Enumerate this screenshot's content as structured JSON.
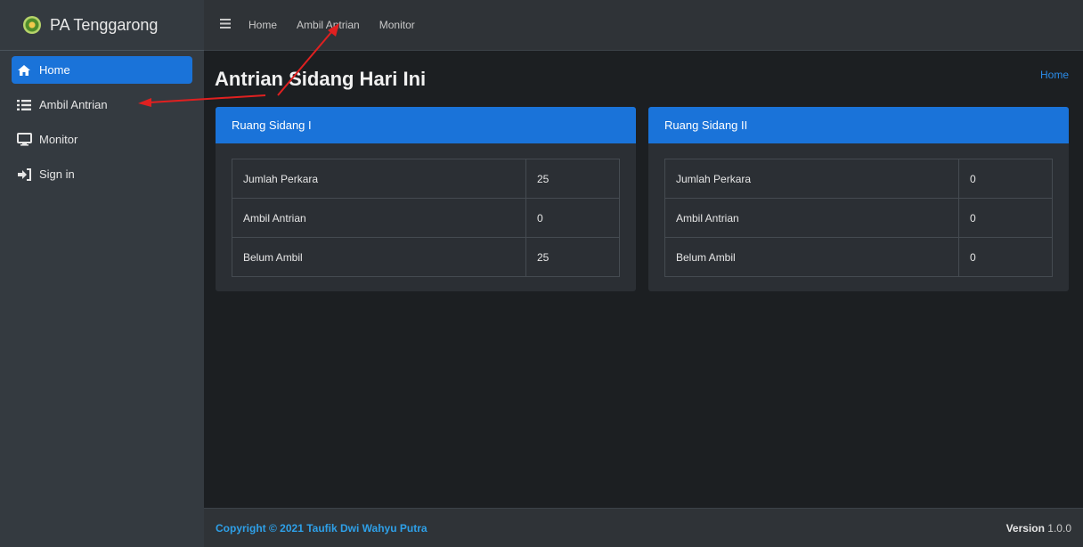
{
  "brand": {
    "name": "PA Tenggarong"
  },
  "sidebar": {
    "items": [
      {
        "label": "Home",
        "icon": "home-icon",
        "active": true
      },
      {
        "label": "Ambil Antrian",
        "icon": "list-icon",
        "active": false
      },
      {
        "label": "Monitor",
        "icon": "monitor-icon",
        "active": false
      },
      {
        "label": "Sign in",
        "icon": "sign-in-icon",
        "active": false
      }
    ]
  },
  "topbar": {
    "links": [
      "Home",
      "Ambil Antrian",
      "Monitor"
    ]
  },
  "page": {
    "title": "Antrian Sidang Hari Ini",
    "breadcrumb": "Home"
  },
  "cards": [
    {
      "title": "Ruang Sidang I",
      "rows": [
        {
          "label": "Jumlah Perkara",
          "value": "25"
        },
        {
          "label": "Ambil Antrian",
          "value": "0"
        },
        {
          "label": "Belum Ambil",
          "value": "25"
        }
      ]
    },
    {
      "title": "Ruang Sidang II",
      "rows": [
        {
          "label": "Jumlah Perkara",
          "value": "0"
        },
        {
          "label": "Ambil Antrian",
          "value": "0"
        },
        {
          "label": "Belum Ambil",
          "value": "0"
        }
      ]
    }
  ],
  "footer": {
    "copyright": "Copyright © 2021 Taufik Dwi Wahyu Putra",
    "version_label": "Version",
    "version_value": "1.0.0"
  },
  "colors": {
    "accent": "#1a73d9",
    "sidebar_bg": "#343a40",
    "content_bg": "#1c1f22",
    "link": "#2ea0e8",
    "annotation_arrow": "#e02020"
  }
}
